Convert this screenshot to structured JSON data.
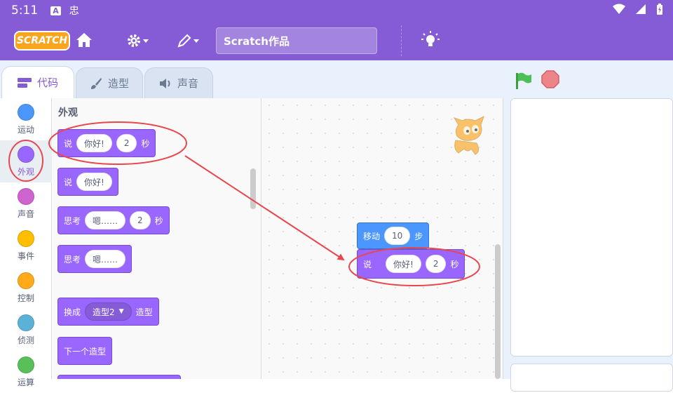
{
  "status_bar": {
    "time": "5:11",
    "icon_1": "A",
    "icon_2": "忠"
  },
  "menu": {
    "logo": "SCRATCH",
    "project_title": "Scratch作品"
  },
  "tabs": [
    {
      "label": "代码",
      "icon": "code-icon"
    },
    {
      "label": "造型",
      "icon": "brush-icon"
    },
    {
      "label": "声音",
      "icon": "speaker-icon"
    }
  ],
  "categories": [
    {
      "label": "运动",
      "color": "#4C97FF"
    },
    {
      "label": "外观",
      "color": "#9966FF"
    },
    {
      "label": "声音",
      "color": "#CF63CF"
    },
    {
      "label": "事件",
      "color": "#FFBF00"
    },
    {
      "label": "控制",
      "color": "#FFAB19"
    },
    {
      "label": "侦测",
      "color": "#5CB1D6"
    },
    {
      "label": "运算",
      "color": "#59C059"
    }
  ],
  "palette": {
    "heading": "外观",
    "blocks": {
      "say_for": {
        "say": "说",
        "text": "你好!",
        "secs": "2",
        "unit": "秒"
      },
      "say": {
        "say": "说",
        "text": "你好!"
      },
      "think_for": {
        "think": "思考",
        "text": "嗯……",
        "secs": "2",
        "unit": "秒"
      },
      "think": {
        "think": "思考",
        "text": "嗯……"
      },
      "switch_costume": {
        "prefix": "换成",
        "costume": "造型2",
        "suffix": "造型"
      },
      "next_costume": {
        "label": "下一个造型"
      }
    }
  },
  "script": {
    "move": {
      "label": "移动",
      "steps": "10",
      "unit": "步"
    },
    "say_for": {
      "say": "说",
      "text": "你好!",
      "secs": "2",
      "unit": "秒"
    }
  },
  "colors": {
    "accent": "#855CD6",
    "looks": "#9966FF",
    "motion": "#4C97FF",
    "annotation": "#E8474F"
  }
}
